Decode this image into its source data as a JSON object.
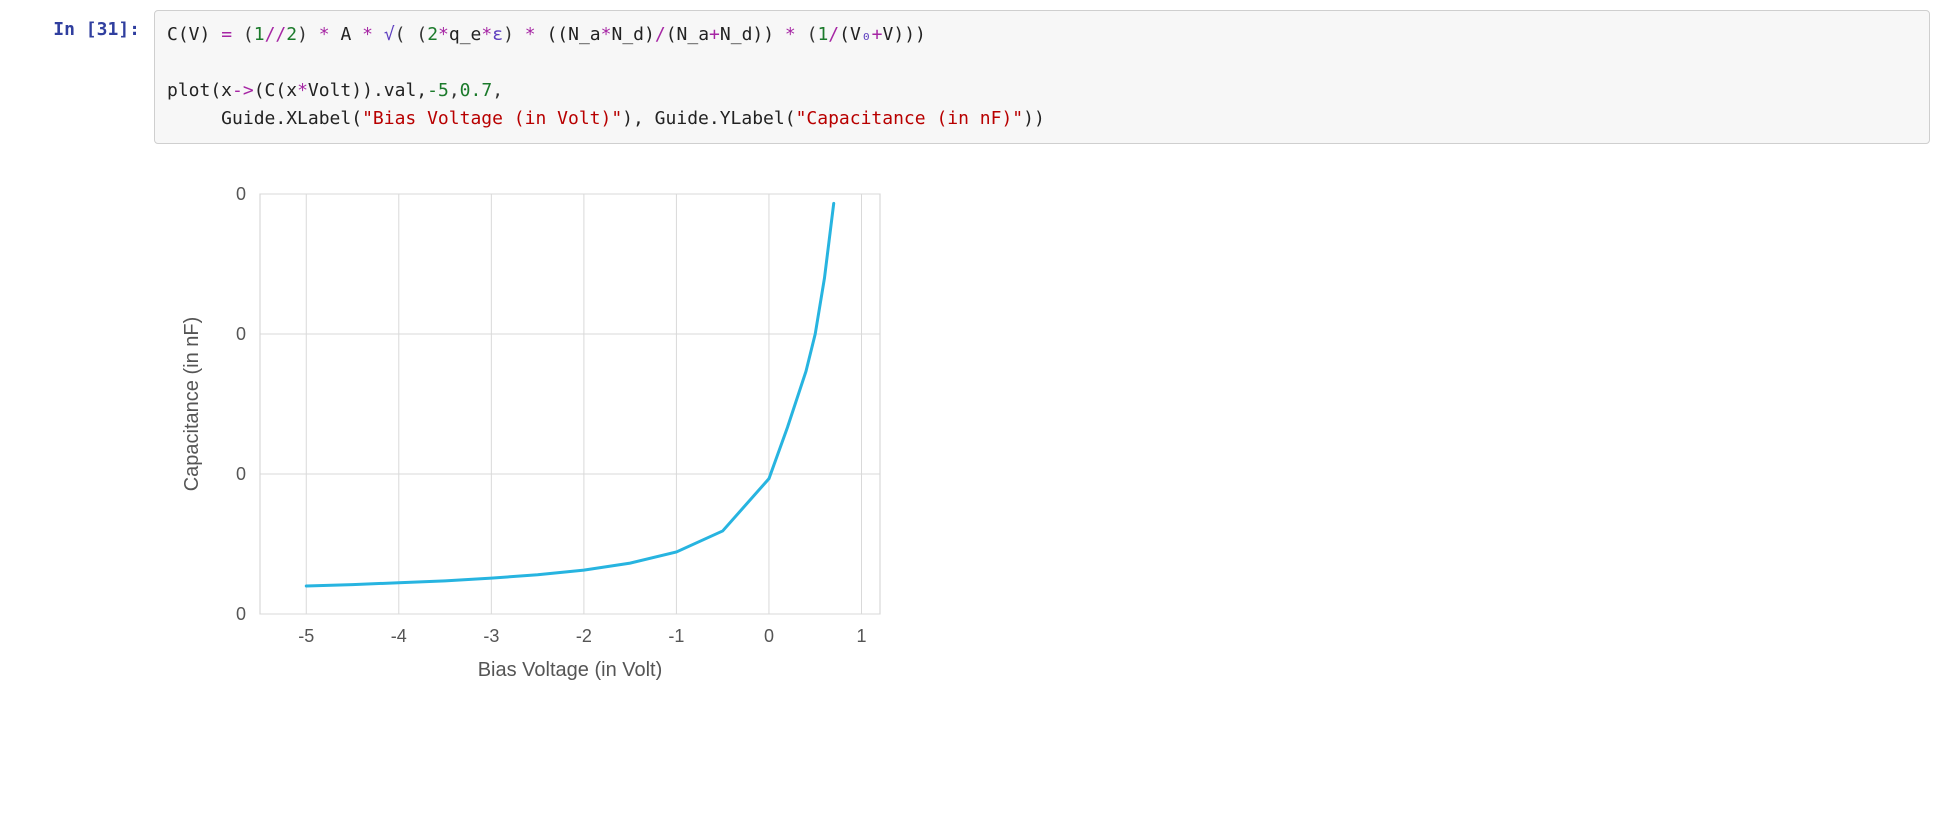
{
  "cell": {
    "prompt": "In [31]:",
    "code_segments": [
      {
        "t": "",
        "c": "plain"
      },
      {
        "t": "C(V) ",
        "c": "plain"
      },
      {
        "t": "=",
        "c": "op"
      },
      {
        "t": " (",
        "c": "punct"
      },
      {
        "t": "1",
        "c": "num"
      },
      {
        "t": "//",
        "c": "op"
      },
      {
        "t": "2",
        "c": "num"
      },
      {
        "t": ") ",
        "c": "punct"
      },
      {
        "t": "*",
        "c": "op"
      },
      {
        "t": " A ",
        "c": "plain"
      },
      {
        "t": "*",
        "c": "op"
      },
      {
        "t": " ",
        "c": "plain"
      },
      {
        "t": "√",
        "c": "sym"
      },
      {
        "t": "( (",
        "c": "punct"
      },
      {
        "t": "2",
        "c": "num"
      },
      {
        "t": "*",
        "c": "op"
      },
      {
        "t": "q_e",
        "c": "plain"
      },
      {
        "t": "*",
        "c": "op"
      },
      {
        "t": "ε",
        "c": "sym"
      },
      {
        "t": ") ",
        "c": "punct"
      },
      {
        "t": "*",
        "c": "op"
      },
      {
        "t": " ((N_a",
        "c": "plain"
      },
      {
        "t": "*",
        "c": "op"
      },
      {
        "t": "N_d)",
        "c": "plain"
      },
      {
        "t": "/",
        "c": "op"
      },
      {
        "t": "(N_a",
        "c": "plain"
      },
      {
        "t": "+",
        "c": "op"
      },
      {
        "t": "N_d)) ",
        "c": "plain"
      },
      {
        "t": "*",
        "c": "op"
      },
      {
        "t": " (",
        "c": "punct"
      },
      {
        "t": "1",
        "c": "num"
      },
      {
        "t": "/",
        "c": "op"
      },
      {
        "t": "(V",
        "c": "plain"
      },
      {
        "t": "₀",
        "c": "sym"
      },
      {
        "t": "+",
        "c": "op"
      },
      {
        "t": "V)))",
        "c": "plain"
      },
      {
        "t": "\n\n",
        "c": "plain"
      },
      {
        "t": "plot(x",
        "c": "plain"
      },
      {
        "t": "->",
        "c": "op"
      },
      {
        "t": "(C(x",
        "c": "plain"
      },
      {
        "t": "*",
        "c": "op"
      },
      {
        "t": "Volt)).val,",
        "c": "plain"
      },
      {
        "t": "-5",
        "c": "num"
      },
      {
        "t": ",",
        "c": "punct"
      },
      {
        "t": "0.7",
        "c": "num"
      },
      {
        "t": ",",
        "c": "punct"
      },
      {
        "t": "\n     Guide.XLabel(",
        "c": "plain"
      },
      {
        "t": "\"Bias Voltage (in Volt)\"",
        "c": "str"
      },
      {
        "t": "), Guide.YLabel(",
        "c": "plain"
      },
      {
        "t": "\"Capacitance (in nF)\"",
        "c": "str"
      },
      {
        "t": "))",
        "c": "plain"
      }
    ]
  },
  "chart_data": {
    "type": "line",
    "title": "",
    "xlabel": "Bias Voltage (in Volt)",
    "ylabel": "Capacitance (in nF)",
    "xlim": [
      -5.5,
      1.2
    ],
    "ylim": [
      0,
      0.9
    ],
    "x_ticks": [
      -5,
      -4,
      -3,
      -2,
      -1,
      0,
      1
    ],
    "y_tick_labels": [
      "0",
      "0",
      "0",
      "0"
    ],
    "series": [
      {
        "name": "C(V)",
        "x": [
          -5.0,
          -4.5,
          -4.0,
          -3.5,
          -3.0,
          -2.5,
          -2.0,
          -1.5,
          -1.0,
          -0.5,
          0.0,
          0.2,
          0.4,
          0.5,
          0.6,
          0.65,
          0.7
        ],
        "y": [
          0.06,
          0.063,
          0.067,
          0.071,
          0.077,
          0.084,
          0.094,
          0.109,
          0.133,
          0.178,
          0.29,
          0.4,
          0.52,
          0.6,
          0.72,
          0.8,
          0.88
        ]
      }
    ]
  }
}
